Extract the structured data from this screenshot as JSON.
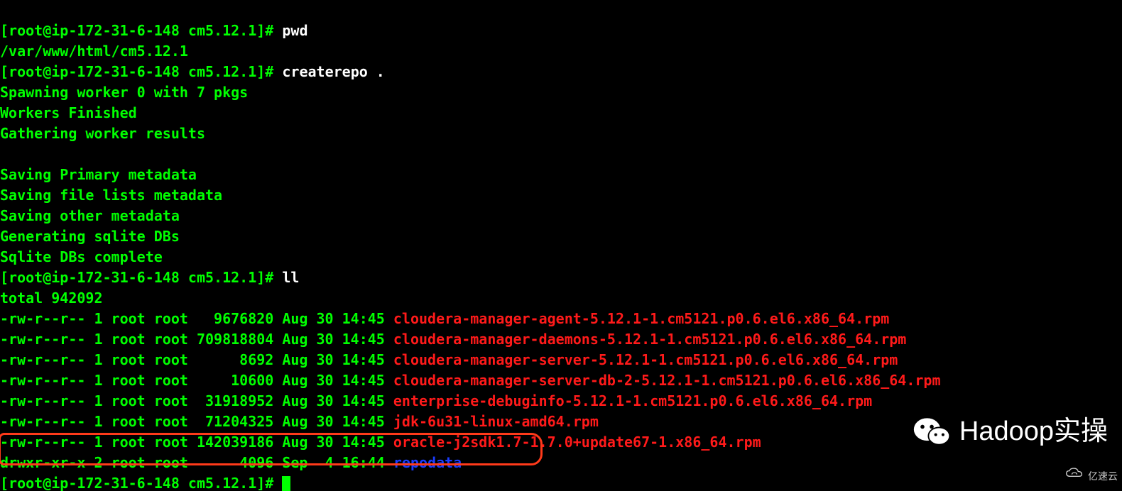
{
  "prompt1": "[root@ip-172-31-6-148 cm5.12.1]# ",
  "cmd_pwd": "pwd",
  "pwd_out": "/var/www/html/cm5.12.1",
  "prompt2": "[root@ip-172-31-6-148 cm5.12.1]# ",
  "cmd_createrepo": "createrepo .",
  "cr_out1": "Spawning worker 0 with 7 pkgs",
  "cr_out2": "Workers Finished",
  "cr_out3": "Gathering worker results",
  "cr_out4": "Saving Primary metadata",
  "cr_out5": "Saving file lists metadata",
  "cr_out6": "Saving other metadata",
  "cr_out7": "Generating sqlite DBs",
  "cr_out8": "Sqlite DBs complete",
  "prompt3": "[root@ip-172-31-6-148 cm5.12.1]# ",
  "cmd_ll": "ll",
  "total": "total 942092",
  "f1_meta": "-rw-r--r-- 1 root root   9676820 Aug 30 14:45 ",
  "f1_name": "cloudera-manager-agent-5.12.1-1.cm5121.p0.6.el6.x86_64.rpm",
  "f2_meta": "-rw-r--r-- 1 root root 709818804 Aug 30 14:45 ",
  "f2_name": "cloudera-manager-daemons-5.12.1-1.cm5121.p0.6.el6.x86_64.rpm",
  "f3_meta": "-rw-r--r-- 1 root root      8692 Aug 30 14:45 ",
  "f3_name": "cloudera-manager-server-5.12.1-1.cm5121.p0.6.el6.x86_64.rpm",
  "f4_meta": "-rw-r--r-- 1 root root     10600 Aug 30 14:45 ",
  "f4_name": "cloudera-manager-server-db-2-5.12.1-1.cm5121.p0.6.el6.x86_64.rpm",
  "f5_meta": "-rw-r--r-- 1 root root  31918952 Aug 30 14:45 ",
  "f5_name": "enterprise-debuginfo-5.12.1-1.cm5121.p0.6.el6.x86_64.rpm",
  "f6_meta": "-rw-r--r-- 1 root root  71204325 Aug 30 14:45 ",
  "f6_name": "jdk-6u31-linux-amd64.rpm",
  "f7_meta": "-rw-r--r-- 1 root root 142039186 Aug 30 14:45 ",
  "f7_name": "oracle-j2sdk1.7-1.7.0+update67-1.x86_64.rpm",
  "d1_meta": "drwxr-xr-x 2 root root      4096 Sep  4 16:44 ",
  "d1_name": "repodata",
  "prompt4": "[root@ip-172-31-6-148 cm5.12.1]# ",
  "watermark_text": "Hadoop实操",
  "corner_text": "亿速云"
}
